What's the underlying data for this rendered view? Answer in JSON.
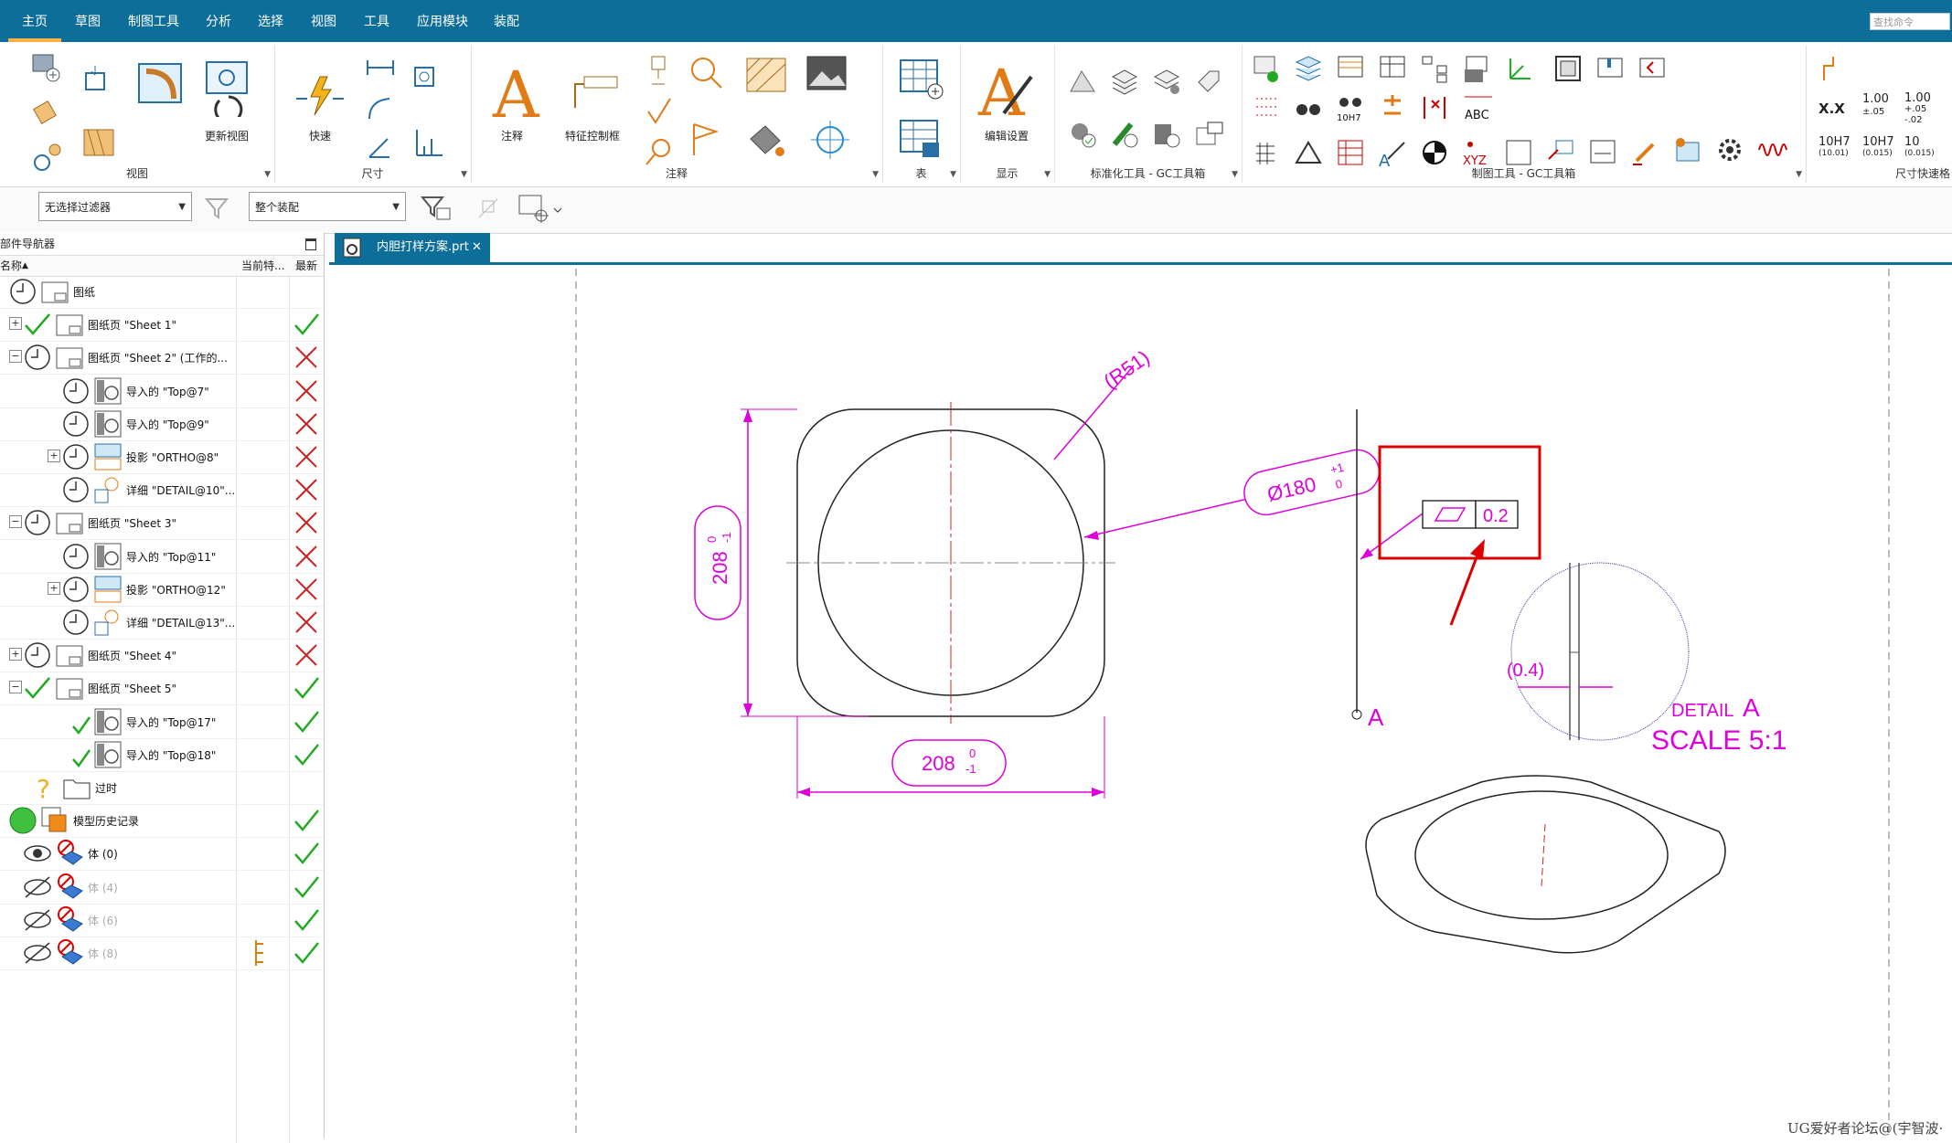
{
  "menu": {
    "items": [
      "主页",
      "草图",
      "制图工具",
      "分析",
      "选择",
      "视图",
      "工具",
      "应用模块",
      "装配"
    ],
    "search_placeholder": "查找命令"
  },
  "ribbon": {
    "groups": [
      "视图",
      "尺寸",
      "注释",
      "表",
      "显示",
      "标准化工具 - GC工具箱",
      "制图工具 - GC工具箱",
      "尺寸快速格"
    ],
    "labels": {
      "update_view": "更新视图",
      "rapid": "快速",
      "note": "注释",
      "fcf": "特征控制框",
      "edit_settings": "编辑设置"
    },
    "tol_buttons": {
      "xx": "X.X",
      "t1_top": "1.00",
      "t1_bot": "±.05",
      "t2_top": "1.00",
      "t2_mid": "+.05",
      "t2_bot": "-.02",
      "t3_top": "1.00",
      "t3_bot": "-.02"
    },
    "fit_buttons": {
      "f1": "10H7",
      "f1_sub": "(10.01)",
      "f2": "10H7",
      "f2_sub": "(0.015)",
      "f3": "10",
      "f3_sub": "(0.015)"
    },
    "misc": {
      "h7": "10H7",
      "abc": "ABC",
      "xyz": "XYZ"
    }
  },
  "toolbar2": {
    "filter": "无选择过滤器",
    "assembly": "整个装配"
  },
  "navigator": {
    "title": "部件导航器",
    "col_name": "名称",
    "col_current": "当前特...",
    "col_latest": "最新",
    "rows": [
      {
        "label": "图纸",
        "status": "none"
      },
      {
        "label": "图纸页 \"Sheet 1\"",
        "status": "ok"
      },
      {
        "label": "图纸页 \"Sheet 2\" (工作的...",
        "status": "x"
      },
      {
        "label": "导入的 \"Top@7\"",
        "status": "x"
      },
      {
        "label": "导入的 \"Top@9\"",
        "status": "x"
      },
      {
        "label": "投影 \"ORTHO@8\"",
        "status": "x"
      },
      {
        "label": "详细 \"DETAIL@10\"...",
        "status": "x"
      },
      {
        "label": "图纸页 \"Sheet 3\"",
        "status": "x"
      },
      {
        "label": "导入的 \"Top@11\"",
        "status": "x"
      },
      {
        "label": "投影 \"ORTHO@12\"",
        "status": "x"
      },
      {
        "label": "详细 \"DETAIL@13\"...",
        "status": "x"
      },
      {
        "label": "图纸页 \"Sheet 4\"",
        "status": "x"
      },
      {
        "label": "图纸页 \"Sheet 5\"",
        "status": "ok"
      },
      {
        "label": "导入的 \"Top@17\"",
        "status": "ok"
      },
      {
        "label": "导入的 \"Top@18\"",
        "status": "ok"
      },
      {
        "label": "过时",
        "status": "none"
      },
      {
        "label": "模型历史记录",
        "status": "ok"
      },
      {
        "label": "体 (0)",
        "status": "ok"
      },
      {
        "label": "体 (4)",
        "status": "ok"
      },
      {
        "label": "体 (6)",
        "status": "ok"
      },
      {
        "label": "体 (8)",
        "status": "ok"
      }
    ]
  },
  "tab": {
    "label": "内胆打样方案.prt"
  },
  "drawing": {
    "radius": "(R51)",
    "dia": "Ø180",
    "dia_tol_up": "+1",
    "dia_tol_low": "0",
    "dim_vert": "208",
    "dim_vert_up": "0",
    "dim_vert_low": "-1",
    "dim_horiz": "208",
    "dim_horiz_up": "0",
    "dim_horiz_low": "-1",
    "gdt_value": "0.2",
    "section_label": "A",
    "detail_dim": "(0.4)",
    "detail_title_a": "DETAIL",
    "detail_title_b": "A",
    "detail_scale": "SCALE 5:1"
  },
  "watermark": "UG爱好者论坛@(宇智波·"
}
